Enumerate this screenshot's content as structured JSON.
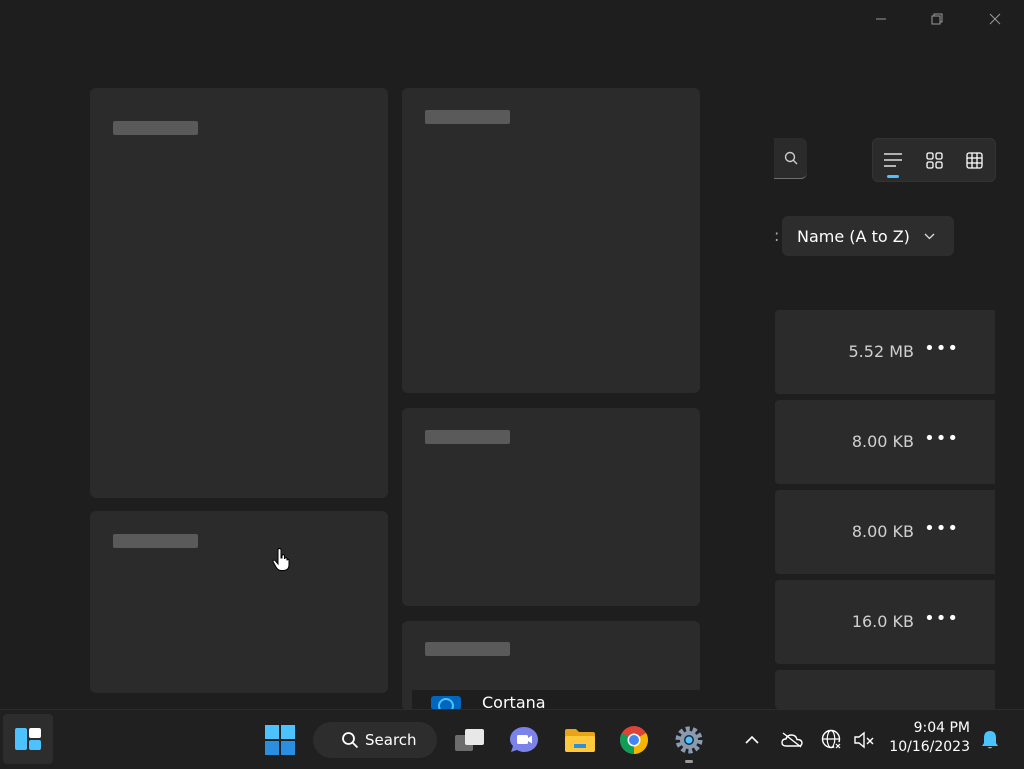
{
  "window": {
    "minimize_icon": "minimize-icon",
    "restore_icon": "restore-icon",
    "close_icon": "close-icon"
  },
  "toolbar": {
    "search_icon": "search-icon",
    "views": [
      "list-view-icon",
      "grid-view-icon",
      "table-view-icon"
    ],
    "active_view": 0,
    "sort_label": "Name (A to Z)",
    "sort_prefix": ":"
  },
  "apps": [
    {
      "size": "5.52 MB"
    },
    {
      "size": "8.00 KB"
    },
    {
      "size": "8.00 KB"
    },
    {
      "size": "16.0 KB"
    }
  ],
  "more_label": "•••",
  "partial_app": {
    "name": "Cortana"
  },
  "taskbar": {
    "search_label": "Search",
    "time": "9:04 PM",
    "date": "10/16/2023"
  },
  "colors": {
    "accent": "#4cc2ff",
    "background": "#1e1e1e",
    "card": "#2b2b2b",
    "taskbar": "#202020"
  }
}
